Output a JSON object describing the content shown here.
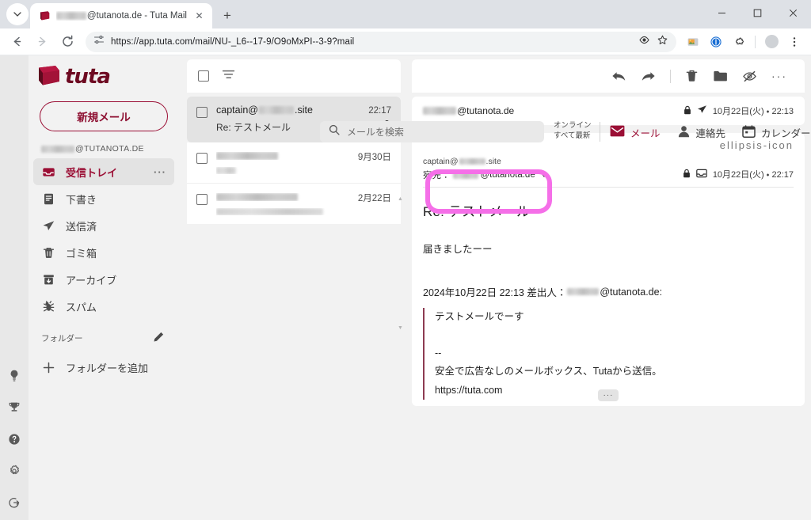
{
  "browser": {
    "tab": {
      "title_redacted": true,
      "title": "@tutanota.de - Tuta Mail",
      "favicon": "tuta-favicon"
    },
    "new_tab_label": "+",
    "close_label": "✕",
    "window": {
      "minimize": "—",
      "maximize": "□",
      "close": "✕"
    },
    "url": "https://app.tuta.com/mail/NU-_L6--17-9/O9oMxPI--3-9?mail",
    "nav": {
      "back": "back-arrow",
      "forward": "forward-arrow",
      "reload": "reload-icon"
    },
    "omnibox_icons": [
      "site-settings-icon",
      "reader-mode-icon",
      "bookmark-star-icon"
    ],
    "extensions": [
      "wallet-extension-icon",
      "1password-extension-icon",
      "extensions-puzzle-icon"
    ],
    "menu": "kebab-menu-icon"
  },
  "app": {
    "logo_text": "tuta",
    "compose_label": "新規メール",
    "account_label": "@TUTANOTA.DE",
    "search": {
      "placeholder": "メールを検索",
      "icon": "search-icon"
    },
    "status": {
      "line1": "オンライン",
      "line2": "すべて最新"
    },
    "header_nav": [
      {
        "label": "メール",
        "icon": "mail-icon",
        "active": true
      },
      {
        "label": "連絡先",
        "icon": "contacts-person-icon",
        "active": false
      },
      {
        "label": "カレンダー",
        "icon": "calendar-icon",
        "active": false
      }
    ],
    "sidebar": {
      "folders": [
        {
          "label": "受信トレイ",
          "icon": "inbox-icon",
          "active": true,
          "more": "···"
        },
        {
          "label": "下書き",
          "icon": "drafts-icon",
          "active": false
        },
        {
          "label": "送信済",
          "icon": "sent-paperplane-icon",
          "active": false
        },
        {
          "label": "ゴミ箱",
          "icon": "trash-icon",
          "active": false
        },
        {
          "label": "アーカイブ",
          "icon": "archive-icon",
          "active": false
        },
        {
          "label": "スパム",
          "icon": "spam-bug-icon",
          "active": false
        }
      ],
      "folders_heading": "フォルダー",
      "edit_icon": "pencil-edit-icon",
      "add_folder_label": "フォルダーを追加",
      "add_folder_icon": "plus-icon"
    },
    "rail_icons": [
      "lightbulb-icon",
      "trophy-icon",
      "help-circle-icon",
      "settings-gear-icon",
      "logout-icon"
    ],
    "list_toolbar": {
      "select_all": "checkbox",
      "filter_icon": "filter-icon"
    },
    "mail_list": [
      {
        "sender": "captain@",
        "sender_suffix": ".site",
        "sender_redacted": true,
        "subject": "Re: テストメール",
        "date": "22:17",
        "encrypted": true,
        "selected": true
      },
      {
        "sender": "",
        "sender_redacted": true,
        "subject": "",
        "subject_redacted": true,
        "date": "9月30日",
        "encrypted": false,
        "selected": false
      },
      {
        "sender": "",
        "sender_redacted": true,
        "subject": "",
        "subject_redacted": true,
        "date": "2月22日",
        "encrypted": false,
        "selected": false
      }
    ],
    "detail_toolbar": [
      {
        "name": "reply-button",
        "icon": "reply-arrow-icon"
      },
      {
        "name": "forward-button",
        "icon": "forward-arrow-icon"
      },
      {
        "name": "delete-button",
        "icon": "trash-icon"
      },
      {
        "name": "move-button",
        "icon": "folder-icon"
      },
      {
        "name": "mark-unread-button",
        "icon": "eye-off-icon"
      },
      {
        "name": "more-button",
        "icon": "ellipsis-icon"
      }
    ],
    "thread": {
      "collapsed_message": {
        "from_suffix": "@tutanota.de",
        "from_redacted": true,
        "icons": [
          "lock-closed-icon",
          "sent-paperplane-icon"
        ],
        "timestamp": "10月22日(火) ・ 22:13"
      },
      "open_message": {
        "more_icon": "ellipsis-icon",
        "from_prefix": "captain@",
        "from_suffix": ".site",
        "from_redacted": true,
        "to_label": "宛先：",
        "to_suffix": "@tutanota.de",
        "to_redacted": true,
        "expand_icon": "chevron-down-icon",
        "icons": [
          "lock-closed-icon",
          "inbox-icon"
        ],
        "timestamp": "10月22日(火) ・ 22:17",
        "subject": "Re: テストメール",
        "body": "届きましたーー",
        "quote_header_before": "2024年10月22日 22:13 差出人：",
        "quote_header_after": "@tutanota.de:",
        "quote_header_redacted": true,
        "quote_lines": [
          "テストメールでーす",
          "",
          "--",
          "安全で広告なしのメールボックス、Tutaから送信。",
          "https://tuta.com"
        ],
        "show_more_label": "···"
      }
    },
    "annotation": {
      "type": "highlight-rectangle",
      "color": "#f56fe8",
      "target": "recipient-address-block"
    }
  },
  "colors": {
    "brand_red": "#9b0f35",
    "logo_dark_red": "#6e0a22",
    "highlight_pink": "#f56fe8",
    "app_bg": "#f2f2f2",
    "panel_white": "#ffffff",
    "selected_gray": "#e3e3e3"
  }
}
